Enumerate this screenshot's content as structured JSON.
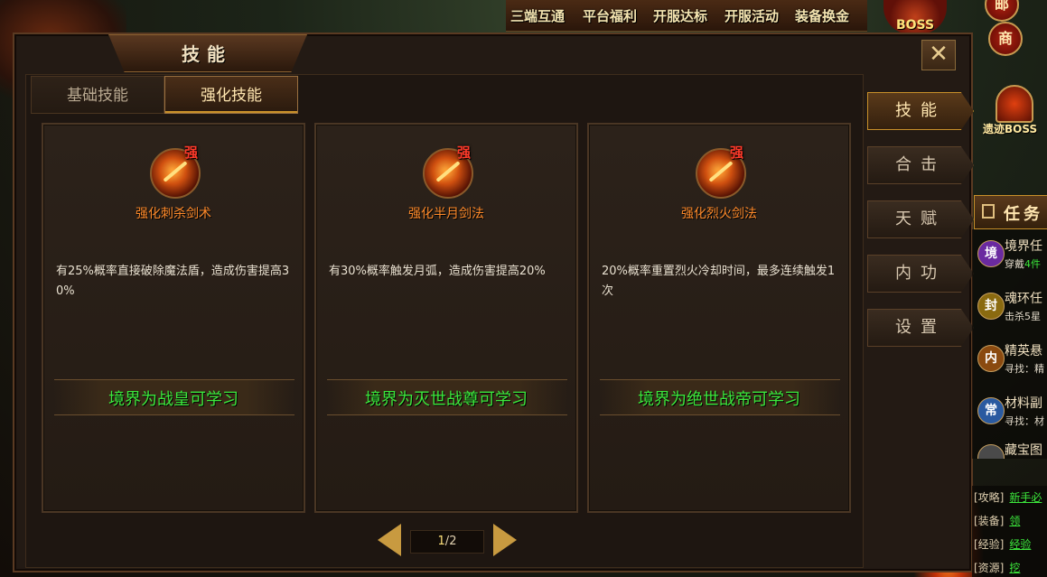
{
  "top_links": [
    "三端互通",
    "平台福利",
    "开服达标",
    "开服活动",
    "装备换金"
  ],
  "top_boss": "BOSS",
  "round_buttons": [
    "邮",
    "商"
  ],
  "panel": {
    "title": "技能",
    "close": "✕",
    "tabs": [
      {
        "label": "基础技能",
        "active": false
      },
      {
        "label": "强化技能",
        "active": true
      }
    ]
  },
  "skills": [
    {
      "badge": "强",
      "name": "强化刺杀剑术",
      "desc": "有25%概率直接破除魔法盾，造成伤害提高30%",
      "requirement": "境界为战皇可学习"
    },
    {
      "badge": "强",
      "name": "强化半月剑法",
      "desc": "有30%概率触发月弧，造成伤害提高20%",
      "requirement": "境界为灭世战尊可学习"
    },
    {
      "badge": "强",
      "name": "强化烈火剑法",
      "desc": "20%概率重置烈火冷却时间，最多连续触发1次",
      "requirement": "境界为绝世战帝可学习"
    }
  ],
  "pager": {
    "current": "1",
    "total": "2"
  },
  "side_tabs": [
    {
      "label": "技能",
      "active": true
    },
    {
      "label": "合击",
      "active": false
    },
    {
      "label": "天赋",
      "active": false
    },
    {
      "label": "内功",
      "active": false
    },
    {
      "label": "设置",
      "active": false
    }
  ],
  "remains_boss": "遗迹BOSS",
  "task_header": "任务",
  "tasks": [
    {
      "orb": "境",
      "title": "境界任",
      "sub": "穿戴",
      "sub_green": "4件",
      "color": "#6a2aa0"
    },
    {
      "orb": "封",
      "title": "魂环任",
      "sub": "击杀5星",
      "sub_green": "",
      "color": "#8a6a10"
    },
    {
      "orb": "内",
      "title": "精英悬",
      "sub": "寻找：精",
      "sub_green": "",
      "color": "#8a4a10"
    },
    {
      "orb": "常",
      "title": "材料副",
      "sub": "寻找：材",
      "sub_green": "",
      "color": "#2a5aa0"
    },
    {
      "orb": "",
      "title": "藏宝图",
      "sub": "",
      "sub_green": "",
      "color": "#4a4a4a"
    }
  ],
  "bottom_links": [
    {
      "key": "[攻略]",
      "val": "新手必"
    },
    {
      "key": "[装备]",
      "val": "领"
    },
    {
      "key": "[经验]",
      "val": "经验"
    },
    {
      "key": "[资源]",
      "val": "挖"
    }
  ]
}
